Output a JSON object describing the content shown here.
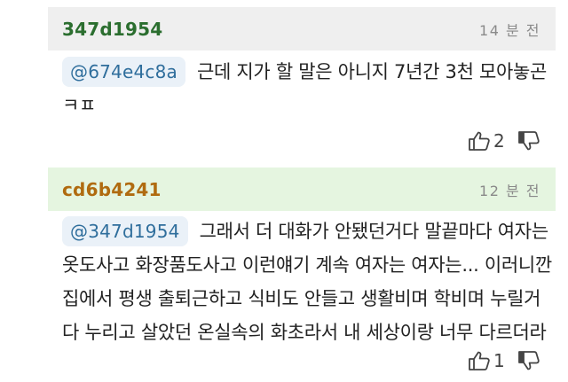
{
  "comments": [
    {
      "author": "347d1954",
      "timestamp": "14 분 전",
      "mention": "@674e4c8a",
      "lines": [
        "근데 지가 할 말은 아니지 7년간 3천 모아놓곤",
        "ㅋㅍ"
      ],
      "like_count": "2",
      "upvote_icon": "thumbs-up-icon",
      "downvote_icon": "thumbs-down-icon"
    },
    {
      "author": "cd6b4241",
      "timestamp": "12 분 전",
      "mention": "@347d1954",
      "lines": [
        "그래서 더 대화가 안됐던거다 말끝마다 여자는",
        "옷도사고 화장품도사고 이런얘기 계속 여자는 여자는... 이러니깐",
        "집에서 평생 출퇴근하고 식비도 안들고 생활비며 학비며 누릴거",
        "다 누리고 살았던 온실속의 화초라서 내 세상이랑 너무 다르더라"
      ],
      "like_count": "1",
      "upvote_icon": "thumbs-up-icon",
      "downvote_icon": "thumbs-down-icon"
    }
  ],
  "colors": {
    "header_gray": "#efefef",
    "header_green": "#e5f5e0",
    "author_green": "#2b6e2f",
    "author_orange": "#b06b10",
    "mention_bg": "#eaf1f8",
    "mention_text": "#2f6e9c"
  }
}
